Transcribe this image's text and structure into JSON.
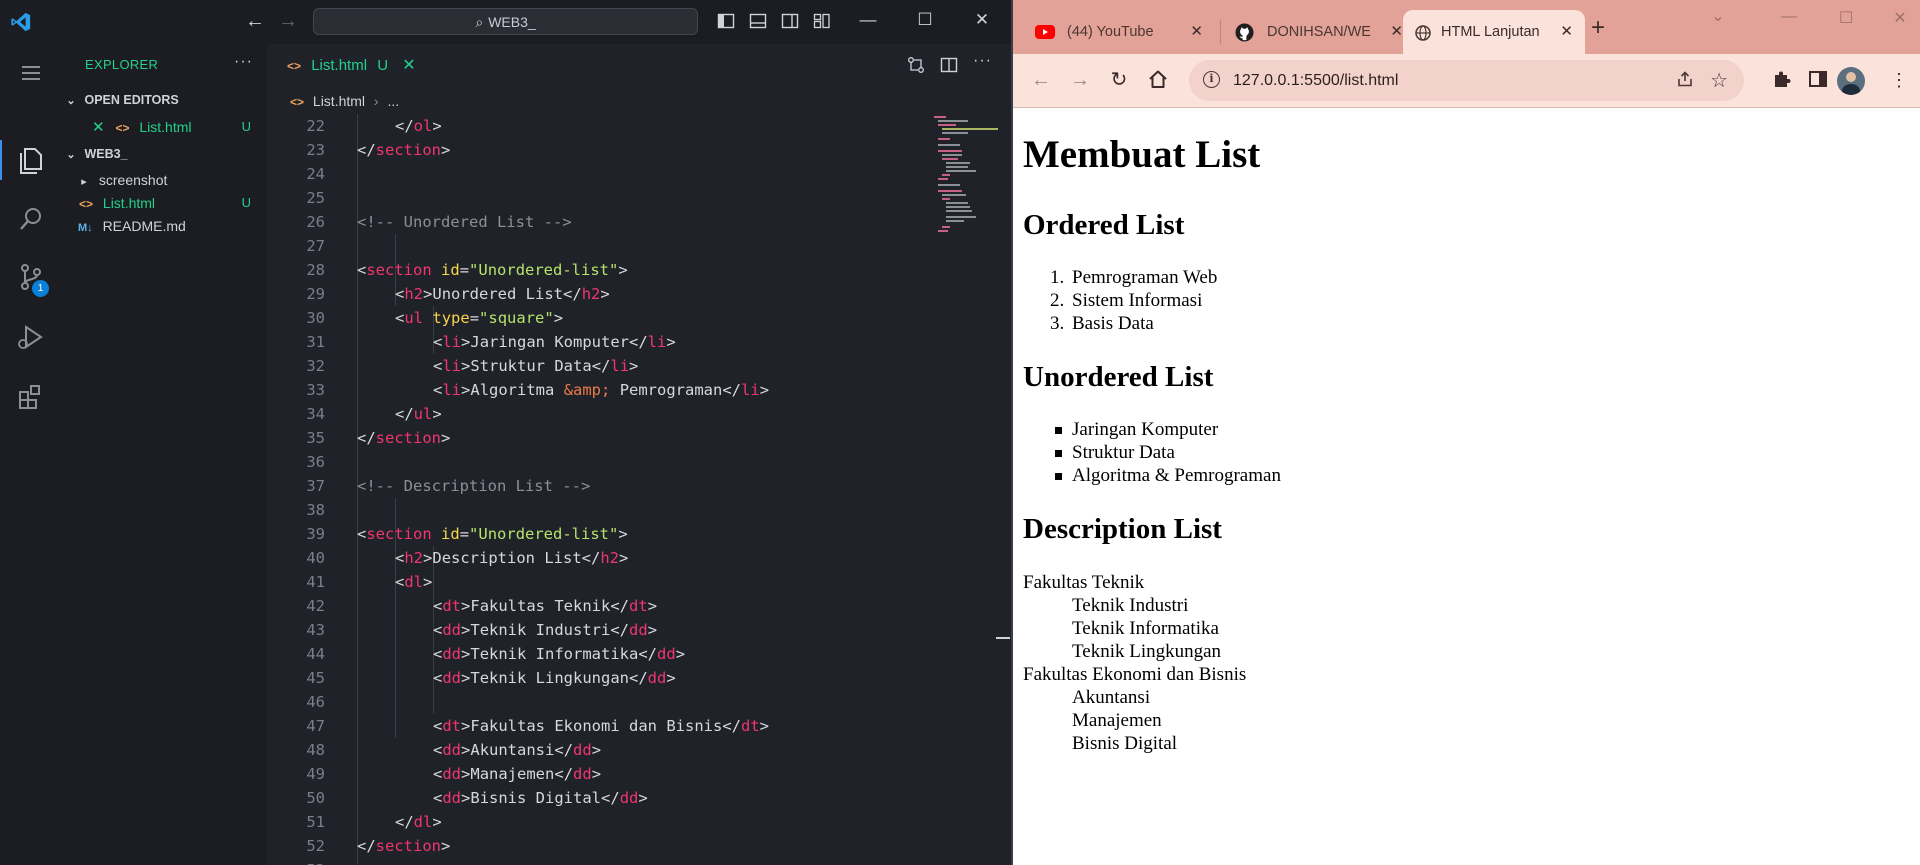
{
  "vscode": {
    "search_text": "WEB3_",
    "sidebar": {
      "title": "EXPLORER",
      "open_editors_label": "OPEN EDITORS",
      "open_editors": [
        {
          "name": "List.html",
          "status": "U"
        }
      ],
      "folder_label": "WEB3_",
      "tree": [
        {
          "name": "screenshot",
          "type": "folder",
          "status": ""
        },
        {
          "name": "List.html",
          "type": "html",
          "status": "U"
        },
        {
          "name": "README.md",
          "type": "markdown",
          "status": ""
        }
      ]
    },
    "source_control_badge": "1",
    "tab": {
      "label": "List.html",
      "status": "U"
    },
    "breadcrumb": {
      "file": "List.html",
      "rest": "..."
    },
    "code_lines": [
      {
        "n": "22",
        "indent": 2,
        "html": "<span class='t-br'>&lt;/</span><span class='t-tag'>ol</span><span class='t-br'>&gt;</span>"
      },
      {
        "n": "23",
        "indent": 1,
        "html": "<span class='t-br'>&lt;/</span><span class='t-tag'>section</span><span class='t-br'>&gt;</span>"
      },
      {
        "n": "24",
        "indent": 0,
        "html": ""
      },
      {
        "n": "25",
        "indent": 0,
        "html": ""
      },
      {
        "n": "26",
        "indent": 1,
        "html": "<span class='t-com'>&lt;!-- Unordered List --&gt;</span>"
      },
      {
        "n": "27",
        "indent": 0,
        "html": ""
      },
      {
        "n": "28",
        "indent": 1,
        "html": "<span class='t-br'>&lt;</span><span class='t-tag'>section</span> <span class='t-attr'>id</span><span class='t-br'>=</span><span class='t-str'>\"Unordered-list\"</span><span class='t-br'>&gt;</span>"
      },
      {
        "n": "29",
        "indent": 2,
        "html": "<span class='t-br'>&lt;</span><span class='t-tag'>h2</span><span class='t-br'>&gt;</span>Unordered List<span class='t-br'>&lt;/</span><span class='t-tag'>h2</span><span class='t-br'>&gt;</span>"
      },
      {
        "n": "30",
        "indent": 2,
        "html": "<span class='t-br'>&lt;</span><span class='t-tag'>ul</span> <span class='t-attr'>type</span><span class='t-br'>=</span><span class='t-str'>\"square\"</span><span class='t-br'>&gt;</span>"
      },
      {
        "n": "31",
        "indent": 3,
        "html": "<span class='t-br'>&lt;</span><span class='t-tag'>li</span><span class='t-br'>&gt;</span>Jaringan Komputer<span class='t-br'>&lt;/</span><span class='t-tag'>li</span><span class='t-br'>&gt;</span>"
      },
      {
        "n": "32",
        "indent": 3,
        "html": "<span class='t-br'>&lt;</span><span class='t-tag'>li</span><span class='t-br'>&gt;</span>Struktur Data<span class='t-br'>&lt;/</span><span class='t-tag'>li</span><span class='t-br'>&gt;</span>"
      },
      {
        "n": "33",
        "indent": 3,
        "html": "<span class='t-br'>&lt;</span><span class='t-tag'>li</span><span class='t-br'>&gt;</span>Algoritma <span class='t-ent'>&amp;amp;</span> Pemrograman<span class='t-br'>&lt;/</span><span class='t-tag'>li</span><span class='t-br'>&gt;</span>"
      },
      {
        "n": "34",
        "indent": 2,
        "html": "<span class='t-br'>&lt;/</span><span class='t-tag'>ul</span><span class='t-br'>&gt;</span>"
      },
      {
        "n": "35",
        "indent": 1,
        "html": "<span class='t-br'>&lt;/</span><span class='t-tag'>section</span><span class='t-br'>&gt;</span>"
      },
      {
        "n": "36",
        "indent": 0,
        "html": ""
      },
      {
        "n": "37",
        "indent": 1,
        "html": "<span class='t-com'>&lt;!-- Description List --&gt;</span>"
      },
      {
        "n": "38",
        "indent": 0,
        "html": ""
      },
      {
        "n": "39",
        "indent": 1,
        "html": "<span class='t-br'>&lt;</span><span class='t-tag'>section</span> <span class='t-attr'>id</span><span class='t-br'>=</span><span class='t-str'>\"Unordered-list\"</span><span class='t-br'>&gt;</span>"
      },
      {
        "n": "40",
        "indent": 2,
        "html": "<span class='t-br'>&lt;</span><span class='t-tag'>h2</span><span class='t-br'>&gt;</span>Description List<span class='t-br'>&lt;/</span><span class='t-tag'>h2</span><span class='t-br'>&gt;</span>"
      },
      {
        "n": "41",
        "indent": 2,
        "html": "<span class='t-br'>&lt;</span><span class='t-tag'>dl</span><span class='t-br'>&gt;</span>"
      },
      {
        "n": "42",
        "indent": 3,
        "html": "<span class='t-br'>&lt;</span><span class='t-tag'>dt</span><span class='t-br'>&gt;</span>Fakultas Teknik<span class='t-br'>&lt;/</span><span class='t-tag'>dt</span><span class='t-br'>&gt;</span>"
      },
      {
        "n": "43",
        "indent": 3,
        "html": "<span class='t-br'>&lt;</span><span class='t-tag'>dd</span><span class='t-br'>&gt;</span>Teknik Industri<span class='t-br'>&lt;/</span><span class='t-tag'>dd</span><span class='t-br'>&gt;</span>"
      },
      {
        "n": "44",
        "indent": 3,
        "html": "<span class='t-br'>&lt;</span><span class='t-tag'>dd</span><span class='t-br'>&gt;</span>Teknik Informatika<span class='t-br'>&lt;/</span><span class='t-tag'>dd</span><span class='t-br'>&gt;</span>"
      },
      {
        "n": "45",
        "indent": 3,
        "html": "<span class='t-br'>&lt;</span><span class='t-tag'>dd</span><span class='t-br'>&gt;</span>Teknik Lingkungan<span class='t-br'>&lt;/</span><span class='t-tag'>dd</span><span class='t-br'>&gt;</span>"
      },
      {
        "n": "46",
        "indent": 0,
        "html": ""
      },
      {
        "n": "47",
        "indent": 3,
        "html": "<span class='t-br'>&lt;</span><span class='t-tag'>dt</span><span class='t-br'>&gt;</span>Fakultas Ekonomi dan Bisnis<span class='t-br'>&lt;/</span><span class='t-tag'>dt</span><span class='t-br'>&gt;</span>"
      },
      {
        "n": "48",
        "indent": 3,
        "html": "<span class='t-br'>&lt;</span><span class='t-tag'>dd</span><span class='t-br'>&gt;</span>Akuntansi<span class='t-br'>&lt;/</span><span class='t-tag'>dd</span><span class='t-br'>&gt;</span>"
      },
      {
        "n": "49",
        "indent": 3,
        "html": "<span class='t-br'>&lt;</span><span class='t-tag'>dd</span><span class='t-br'>&gt;</span>Manajemen<span class='t-br'>&lt;/</span><span class='t-tag'>dd</span><span class='t-br'>&gt;</span>"
      },
      {
        "n": "50",
        "indent": 3,
        "html": "<span class='t-br'>&lt;</span><span class='t-tag'>dd</span><span class='t-br'>&gt;</span>Bisnis Digital<span class='t-br'>&lt;/</span><span class='t-tag'>dd</span><span class='t-br'>&gt;</span>"
      },
      {
        "n": "51",
        "indent": 2,
        "html": "<span class='t-br'>&lt;/</span><span class='t-tag'>dl</span><span class='t-br'>&gt;</span>"
      },
      {
        "n": "52",
        "indent": 1,
        "html": "<span class='t-br'>&lt;/</span><span class='t-tag'>section</span><span class='t-br'>&gt;</span>"
      },
      {
        "n": "53",
        "indent": 0,
        "html": ""
      }
    ]
  },
  "chrome": {
    "tabs": [
      {
        "label": "(44) YouTube",
        "icon": "youtube-icon",
        "active": false
      },
      {
        "label": "DONIHSAN/WE",
        "icon": "github-icon",
        "active": false
      },
      {
        "label": "HTML Lanjutan",
        "icon": "globe-icon",
        "active": true
      }
    ],
    "url": "127.0.0.1:5500/list.html",
    "page": {
      "h1": "Membuat List",
      "ordered_heading": "Ordered List",
      "ordered_items": [
        "Pemrograman Web",
        "Sistem Informasi",
        "Basis Data"
      ],
      "unordered_heading": "Unordered List",
      "unordered_items": [
        "Jaringan Komputer",
        "Struktur Data",
        "Algoritma & Pemrograman"
      ],
      "description_heading": "Description List",
      "description": [
        {
          "dt": "Fakultas Teknik",
          "dd": [
            "Teknik Industri",
            "Teknik Informatika",
            "Teknik Lingkungan"
          ]
        },
        {
          "dt": "Fakultas Ekonomi dan Bisnis",
          "dd": [
            "Akuntansi",
            "Manajemen",
            "Bisnis Digital"
          ]
        }
      ]
    }
  },
  "colors": {
    "vscode_bg": "#1f2228",
    "vscode_accent": "#23d18b",
    "chrome_frame": "#e2a297",
    "chrome_toolbar": "#fbe3dc"
  }
}
